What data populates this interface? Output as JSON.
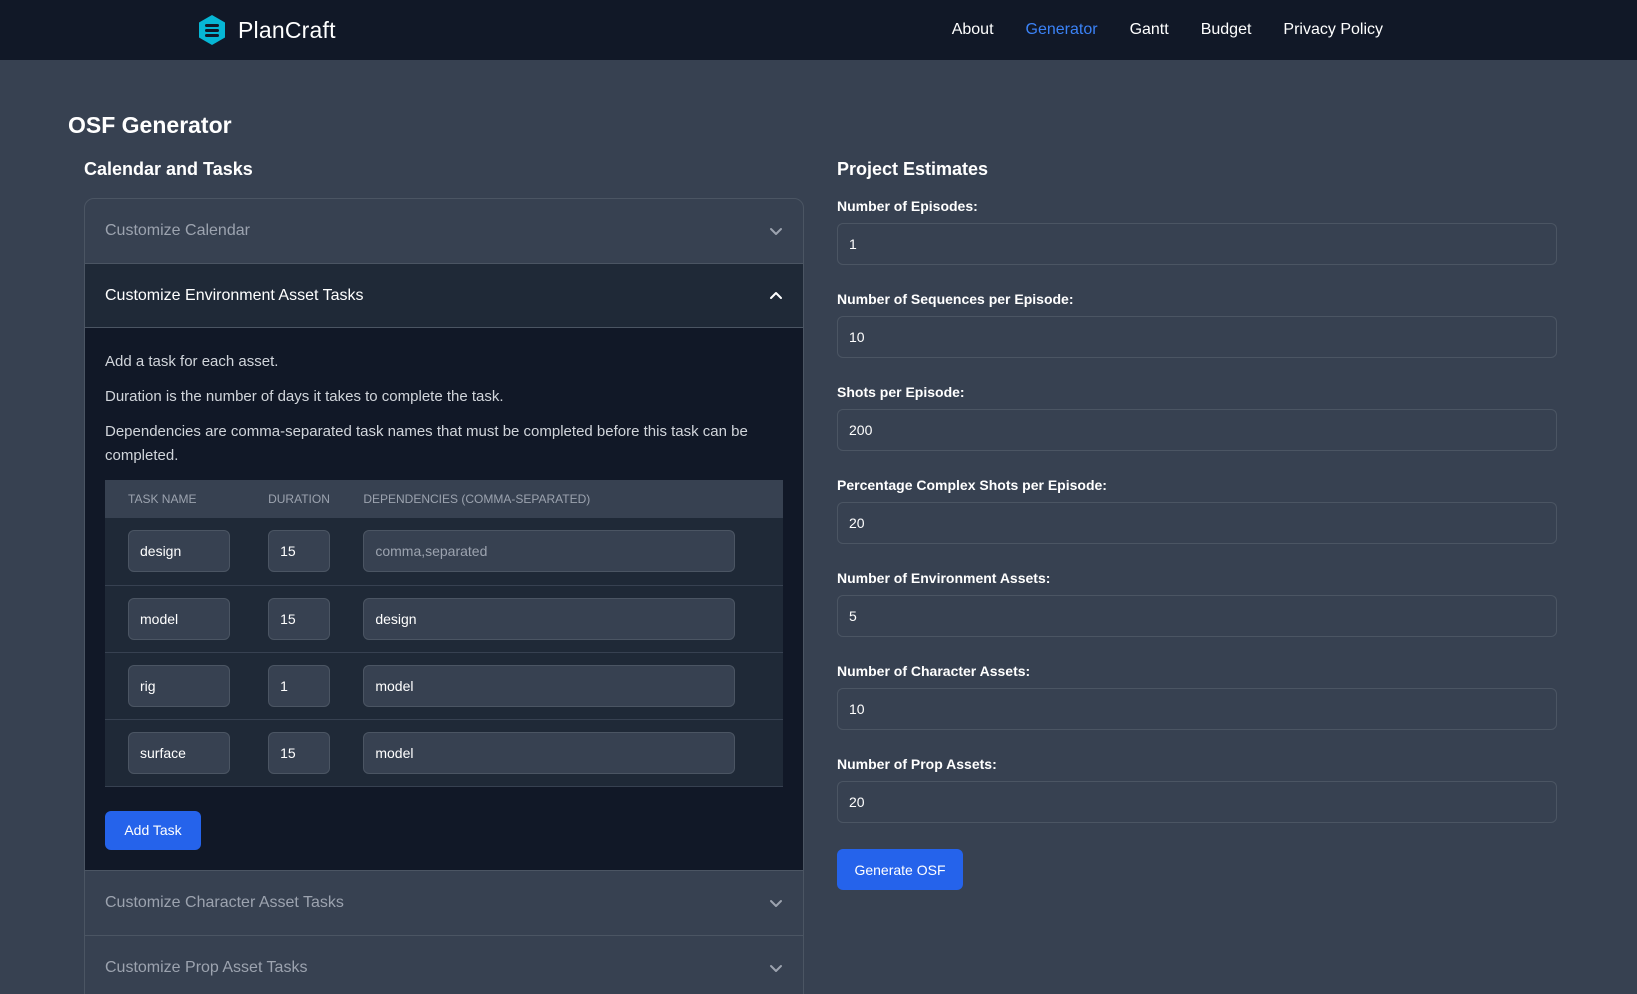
{
  "brand": {
    "name": "PlanCraft",
    "logo_icon": "stacked-layers-icon"
  },
  "nav": {
    "links": [
      {
        "label": "About",
        "active": false
      },
      {
        "label": "Generator",
        "active": true
      },
      {
        "label": "Gantt",
        "active": false
      },
      {
        "label": "Budget",
        "active": false
      },
      {
        "label": "Privacy Policy",
        "active": false
      }
    ]
  },
  "page": {
    "title": "OSF Generator"
  },
  "left": {
    "section_title": "Calendar and Tasks",
    "accordion": {
      "calendar": "Customize Calendar",
      "environment": "Customize Environment Asset Tasks",
      "character": "Customize Character Asset Tasks",
      "prop": "Customize Prop Asset Tasks"
    },
    "environment_body": {
      "line1": "Add a task for each asset.",
      "line2": "Duration is the number of days it takes to complete the task.",
      "line3": "Dependencies are comma-separated task names that must be completed before this task can be completed.",
      "headers": {
        "name": "Task Name",
        "duration": "Duration",
        "deps": "Dependencies (Comma-Separated)"
      },
      "rows": [
        {
          "name": "design",
          "duration": "15",
          "deps": ""
        },
        {
          "name": "model",
          "duration": "15",
          "deps": "design"
        },
        {
          "name": "rig",
          "duration": "1",
          "deps": "model"
        },
        {
          "name": "surface",
          "duration": "15",
          "deps": "model"
        }
      ],
      "deps_placeholder": "comma,separated",
      "add_task_label": "Add Task"
    }
  },
  "right": {
    "section_title": "Project Estimates",
    "fields": {
      "episodes": {
        "label": "Number of Episodes:",
        "value": "1"
      },
      "sequences": {
        "label": "Number of Sequences per Episode:",
        "value": "10"
      },
      "shots": {
        "label": "Shots per Episode:",
        "value": "200"
      },
      "complex": {
        "label": "Percentage Complex Shots per Episode:",
        "value": "20"
      },
      "env_assets": {
        "label": "Number of Environment Assets:",
        "value": "5"
      },
      "char_assets": {
        "label": "Number of Character Assets:",
        "value": "10"
      },
      "prop_assets": {
        "label": "Number of Prop Assets:",
        "value": "20"
      }
    },
    "generate_label": "Generate OSF"
  },
  "colors": {
    "accent": "#2563eb",
    "nav_active": "#3b82f6",
    "background": "#374151",
    "navbar": "#111827"
  }
}
